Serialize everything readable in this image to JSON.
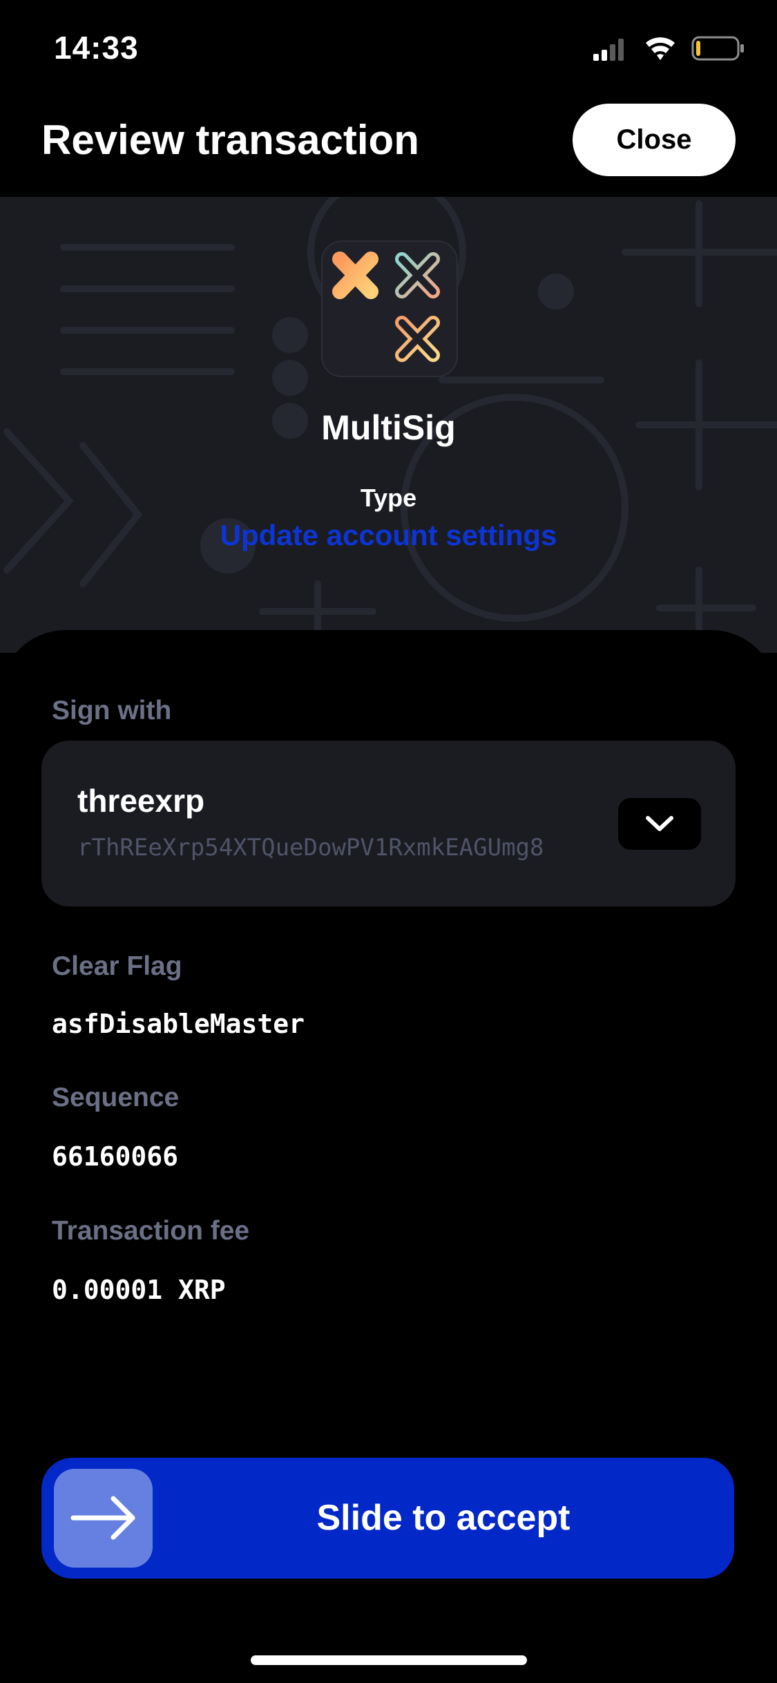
{
  "status_bar": {
    "time": "14:33",
    "icons": [
      "cellular-signal-icon",
      "wifi-icon",
      "battery-icon"
    ]
  },
  "header": {
    "title": "Review transaction",
    "close_label": "Close"
  },
  "hero": {
    "app_icon": "multisig-x-logo-icon",
    "app_name": "MultiSig",
    "type_label": "Type",
    "type_value": "Update account settings"
  },
  "sign_with": {
    "label": "Sign with",
    "account_name": "threexrp",
    "account_address": "rThREeXrp54XTQueDowPV1RxmkEAGUmg8",
    "dropdown_icon": "chevron-down-icon"
  },
  "fields": [
    {
      "label": "Clear Flag",
      "value": "asfDisableMaster"
    },
    {
      "label": "Sequence",
      "value": "66160066"
    },
    {
      "label": "Transaction fee",
      "value": "0.00001 XRP"
    }
  ],
  "slider": {
    "label": "Slide to accept",
    "icon": "arrow-right-icon"
  },
  "colors": {
    "background": "#000000",
    "hero_background": "#1b1c22",
    "accent_blue": "#0228c8",
    "link_blue": "#0d35d6",
    "muted_label": "#6b7086"
  }
}
